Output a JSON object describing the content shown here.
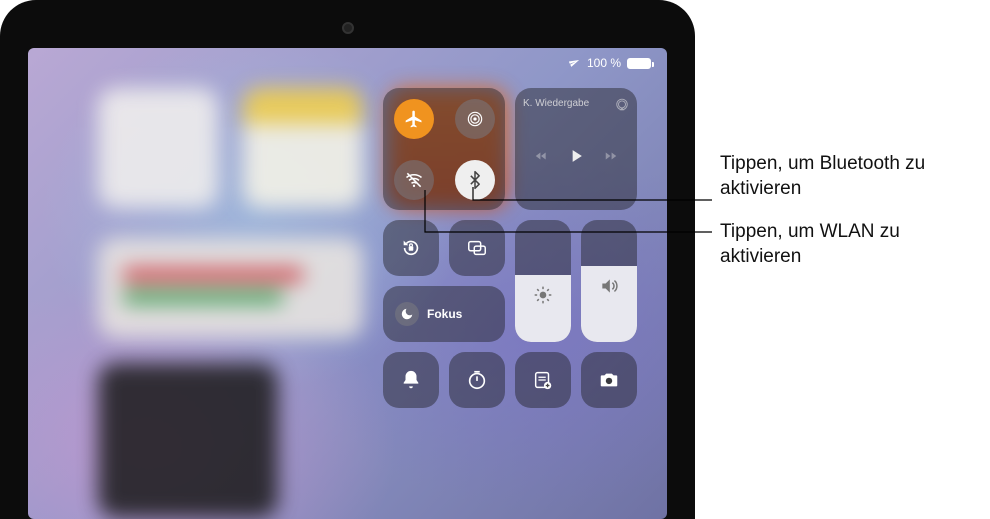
{
  "status": {
    "battery_text": "100 %"
  },
  "control_center": {
    "connectivity": {
      "airplane": "airplane-icon",
      "airdrop": "airdrop-icon",
      "wifi_off": "wifi-off-icon",
      "bluetooth": "bluetooth-icon"
    },
    "media": {
      "label": "K. Wiedergabe",
      "airplay_icon": "airplay-icon"
    },
    "focus": {
      "label": "Fokus"
    }
  },
  "callouts": {
    "bluetooth": "Tippen, um Bluetooth zu aktivieren",
    "wlan": "Tippen, um WLAN zu aktivieren"
  }
}
